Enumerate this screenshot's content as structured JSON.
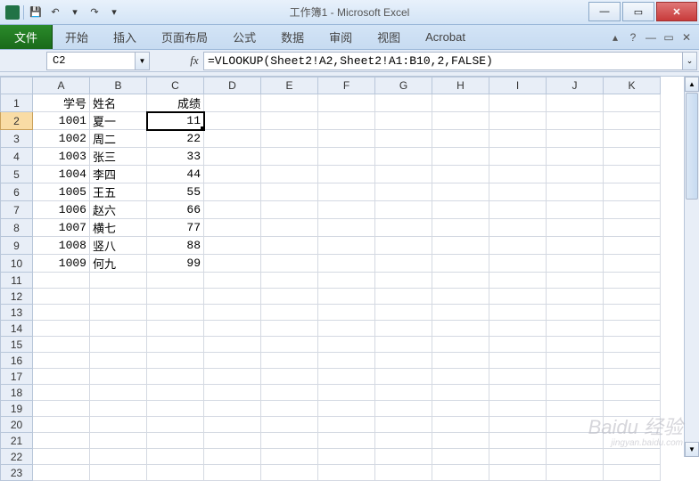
{
  "titlebar": {
    "title": "工作簿1 - Microsoft Excel",
    "qat": {
      "save": "💾",
      "undo": "↶",
      "redo": "↷",
      "dd": "▾"
    }
  },
  "ribbon": {
    "file": "文件",
    "tabs": [
      "开始",
      "插入",
      "页面布局",
      "公式",
      "数据",
      "审阅",
      "视图",
      "Acrobat"
    ],
    "help": "?"
  },
  "formulabar": {
    "namebox": "C2",
    "fx": "fx",
    "formula": "=VLOOKUP(Sheet2!A2,Sheet2!A1:B10,2,FALSE)"
  },
  "columns": [
    "A",
    "B",
    "C",
    "D",
    "E",
    "F",
    "G",
    "H",
    "I",
    "J",
    "K"
  ],
  "rows": [
    1,
    2,
    3,
    4,
    5,
    6,
    7,
    8,
    9,
    10,
    11,
    12,
    13,
    14,
    15,
    16,
    17,
    18,
    19,
    20,
    21,
    22,
    23
  ],
  "headers_row": {
    "A": "学号",
    "B": "姓名",
    "C": "成绩"
  },
  "data_rows": [
    {
      "A": "1001",
      "B": "夏一",
      "C": "11"
    },
    {
      "A": "1002",
      "B": "周二",
      "C": "22"
    },
    {
      "A": "1003",
      "B": "张三",
      "C": "33"
    },
    {
      "A": "1004",
      "B": "李四",
      "C": "44"
    },
    {
      "A": "1005",
      "B": "王五",
      "C": "55"
    },
    {
      "A": "1006",
      "B": "赵六",
      "C": "66"
    },
    {
      "A": "1007",
      "B": "横七",
      "C": "77"
    },
    {
      "A": "1008",
      "B": "竖八",
      "C": "88"
    },
    {
      "A": "1009",
      "B": "何九",
      "C": "99"
    }
  ],
  "selected_cell": "C2",
  "watermark": {
    "brand": "Baidu 经验",
    "sub": "jingyan.baidu.com"
  }
}
